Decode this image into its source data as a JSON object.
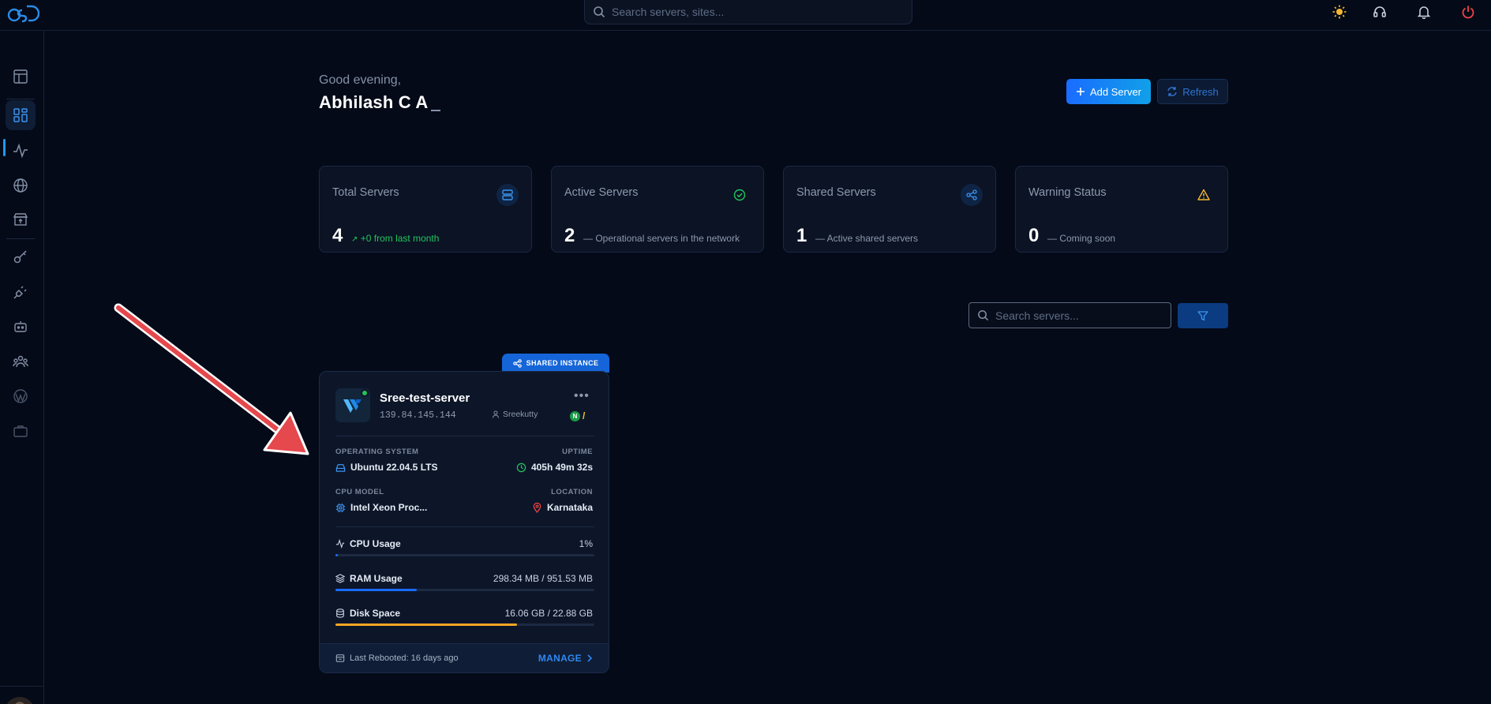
{
  "topbar": {
    "search_placeholder": "Search servers, sites..."
  },
  "greeting": {
    "salutation": "Good evening,",
    "name": "Abhilash C A"
  },
  "actions": {
    "add_server": "Add Server",
    "refresh": "Refresh"
  },
  "stats": [
    {
      "title": "Total Servers",
      "value": "4",
      "sub": "+0 from last month",
      "color": "#22c55e"
    },
    {
      "title": "Active Servers",
      "value": "2",
      "sub": "Operational servers in the network"
    },
    {
      "title": "Shared Servers",
      "value": "1",
      "sub": "Active shared servers"
    },
    {
      "title": "Warning Status",
      "value": "0",
      "sub": "Coming soon"
    }
  ],
  "filter": {
    "search_placeholder": "Search servers..."
  },
  "server": {
    "badge": "SHARED INSTANCE",
    "name": "Sree-test-server",
    "ip": "139.84.145.144",
    "owner": "Sreekutty",
    "tag": "N",
    "os_label": "OPERATING SYSTEM",
    "os_value": "Ubuntu 22.04.5 LTS",
    "uptime_label": "UPTIME",
    "uptime_value": "405h 49m 32s",
    "cpu_model_label": "CPU MODEL",
    "cpu_model_value": "Intel Xeon Proc...",
    "location_label": "LOCATION",
    "location_value": "Karnataka",
    "cpu_usage_label": "CPU Usage",
    "cpu_usage_value": "1%",
    "cpu_usage_fraction": 0.01,
    "ram_label": "RAM Usage",
    "ram_value": "298.34 MB / 951.53 MB",
    "ram_fraction": 0.3135,
    "disk_label": "Disk Space",
    "disk_value": "16.06 GB / 22.88 GB",
    "disk_fraction": 0.7019,
    "rebooted": "Last Rebooted: 16 days ago",
    "manage": "MANAGE"
  },
  "colors": {
    "accent": "#1a6cff",
    "success": "#22c55e",
    "warning": "#f5b731",
    "danger": "#ef4444",
    "disk_bar": "#f5a623"
  }
}
